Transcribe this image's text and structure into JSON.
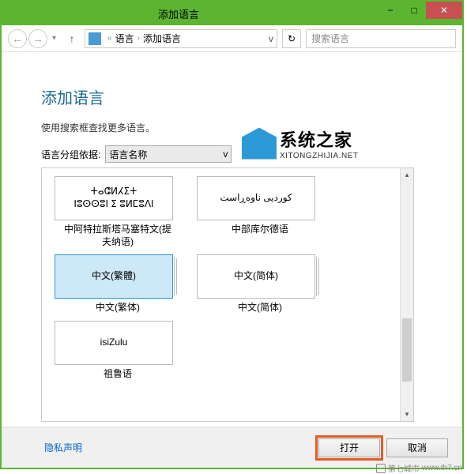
{
  "window": {
    "title": "添加语言",
    "controls": {
      "min": "−",
      "max": "□",
      "close": "✕"
    }
  },
  "nav": {
    "back": "←",
    "forward": "→",
    "dropdown_chevron": "▾",
    "up": "↑",
    "breadcrumb": {
      "sep1": "«",
      "item1": "语言",
      "sep2": "›",
      "item2": "添加语言",
      "chevron": "v"
    },
    "refresh": "↻",
    "search_placeholder": "搜索语言"
  },
  "page": {
    "title": "添加语言",
    "subtitle": "使用搜索框查找更多语言。",
    "group_label": "语言分组依据:",
    "group_value": "语言名称",
    "group_chevron": "v"
  },
  "languages": [
    {
      "native_line1": "ⵜⴰⵛⵍⵃⵉⵜ",
      "native_line2": "ⵏⵓⵙⵙⵓⵏ ⵉ ⵓⵍⵎⵓⴷⵏ",
      "label_line1": "中阿特拉斯塔马塞特文(提",
      "label_line2": "夫纳语)",
      "stacked": false,
      "selected": false
    },
    {
      "native_line1": "کوردیی ناوەڕاست",
      "native_line2": "",
      "label_line1": "中部库尔德语",
      "label_line2": "",
      "stacked": false,
      "selected": false
    },
    {
      "native_line1": "中文(繁體)",
      "native_line2": "",
      "label_line1": "中文(繁体)",
      "label_line2": "",
      "stacked": true,
      "selected": true
    },
    {
      "native_line1": "中文(简体)",
      "native_line2": "",
      "label_line1": "中文(简体)",
      "label_line2": "",
      "stacked": true,
      "selected": false
    },
    {
      "native_line1": "isiZulu",
      "native_line2": "",
      "label_line1": "祖鲁语",
      "label_line2": "",
      "stacked": false,
      "selected": false
    }
  ],
  "scrollbar": {
    "up": "▴",
    "down": "▾"
  },
  "footer": {
    "privacy": "隐私声明",
    "open": "打开",
    "cancel": "取消"
  },
  "watermarks": {
    "site1_cn": "系统之家",
    "site1_en": "XITONGZHIJIA.NET",
    "site2": "第七城市",
    "site2_url": "www.th7.cn"
  }
}
